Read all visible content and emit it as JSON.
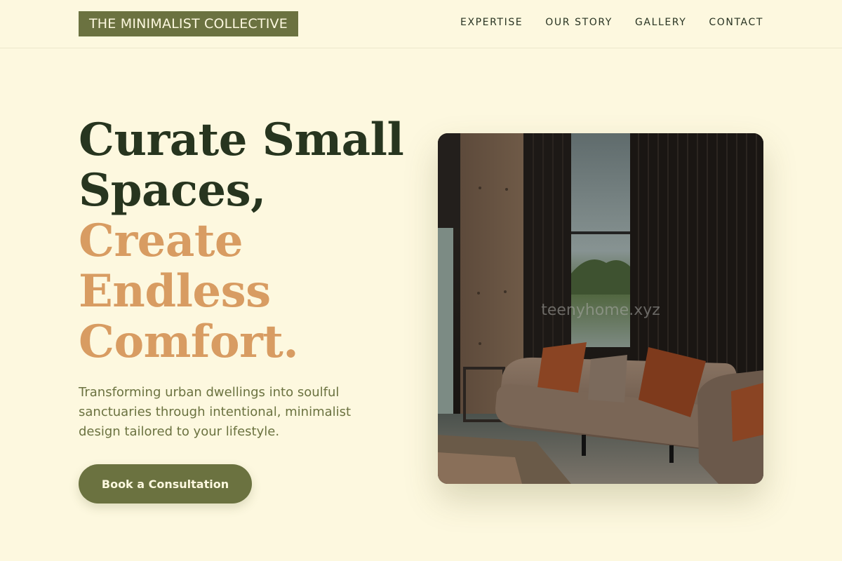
{
  "header": {
    "logo": "THE MINIMALIST COLLECTIVE",
    "nav": [
      "EXPERTISE",
      "OUR STORY",
      "GALLERY",
      "CONTACT"
    ]
  },
  "hero": {
    "headline_dark": [
      "Curate Small",
      "Spaces,"
    ],
    "headline_accent": [
      "Create",
      "Endless",
      "Comfort."
    ],
    "subtitle": "Transforming urban dwellings into soulful sanctuaries through intentional, minimalist design tailored to your lifestyle.",
    "cta_label": "Book a Consultation",
    "image_watermark": "teenyhome.xyz"
  },
  "colors": {
    "background": "#fdf8df",
    "brand_olive": "#6b7240",
    "headline_dark": "#27351f",
    "headline_accent": "#d89c62"
  }
}
